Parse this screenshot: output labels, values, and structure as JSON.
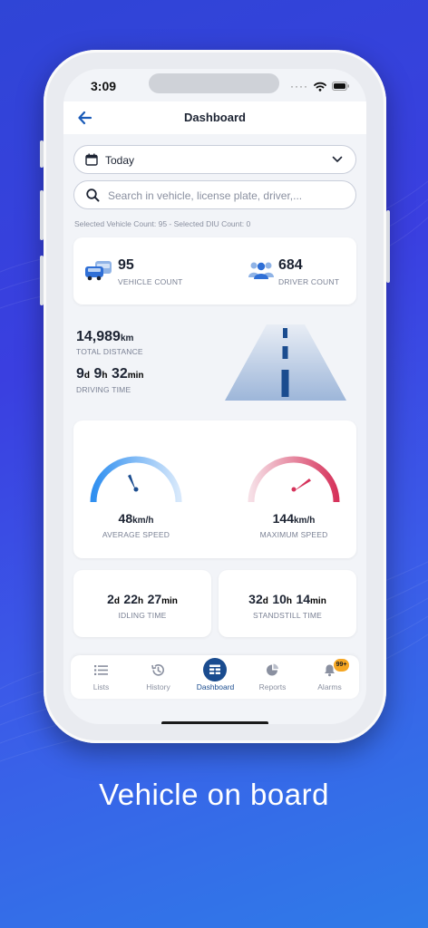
{
  "status_bar": {
    "time": "3:09"
  },
  "header": {
    "title": "Dashboard"
  },
  "date_filter": {
    "value": "Today"
  },
  "search": {
    "placeholder": "Search in vehicle, license plate, driver,..."
  },
  "selected_count_text": "Selected Vehicle Count: 95 - Selected DIU Count: 0",
  "counts": {
    "vehicle_count": "95",
    "vehicle_label": "VEHICLE COUNT",
    "driver_count": "684",
    "driver_label": "DRIVER COUNT"
  },
  "distance": {
    "value": "14,989",
    "unit": "km",
    "label": "TOTAL DISTANCE"
  },
  "driving_time": {
    "days": "9",
    "d_unit": "d",
    "hours": "9",
    "h_unit": "h",
    "minutes": "32",
    "m_unit": "min",
    "label": "DRIVING TIME"
  },
  "speed": {
    "average_value": "48",
    "average_unit": "km/h",
    "average_label": "AVERAGE SPEED",
    "maximum_value": "144",
    "maximum_unit": "km/h",
    "maximum_label": "MAXIMUM SPEED"
  },
  "idling": {
    "days": "2",
    "d_unit": "d",
    "hours": "22",
    "h_unit": "h",
    "minutes": "27",
    "m_unit": "min",
    "label": "IDLING TIME"
  },
  "standstill": {
    "days": "32",
    "d_unit": "d",
    "hours": "10",
    "h_unit": "h",
    "minutes": "14",
    "m_unit": "min",
    "label": "STANDSTILL TIME"
  },
  "tabs": [
    {
      "label": "Lists",
      "icon": "list-icon"
    },
    {
      "label": "History",
      "icon": "history-icon"
    },
    {
      "label": "Dashboard",
      "icon": "dashboard-icon",
      "active": true
    },
    {
      "label": "Reports",
      "icon": "pie-chart-icon"
    },
    {
      "label": "Alarms",
      "icon": "bell-icon",
      "badge": "99+"
    }
  ],
  "caption": "Vehicle on board",
  "colors": {
    "accent": "#1a5bb8",
    "nav_active": "#1a4c8f",
    "badge": "#f5a623",
    "avg_gauge": "#2f8ff0",
    "max_gauge": "#d6335b"
  }
}
